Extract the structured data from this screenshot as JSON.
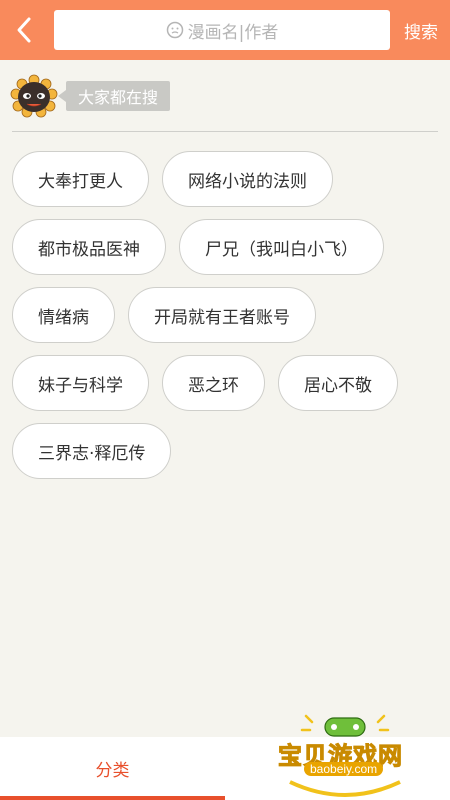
{
  "header": {
    "search_placeholder": "漫画名|作者",
    "search_button": "搜索"
  },
  "hot": {
    "label": "大家都在搜",
    "tags": [
      "大奉打更人",
      "网络小说的法则",
      "都市极品医神",
      "尸兄（我叫白小飞）",
      "情绪病",
      "开局就有王者账号",
      "妹子与科学",
      "恶之环",
      "居心不敬",
      "三界志·释厄传"
    ]
  },
  "bottom_nav": {
    "items": [
      {
        "label": "分类",
        "active": true
      },
      {
        "label": "",
        "active": false
      }
    ]
  },
  "watermark": {
    "text": "宝贝游戏网",
    "url": "baobeiy.com"
  },
  "colors": {
    "header_bg": "#f98a5c",
    "page_bg": "#f5f4ee",
    "active_tab": "#e8502c"
  }
}
